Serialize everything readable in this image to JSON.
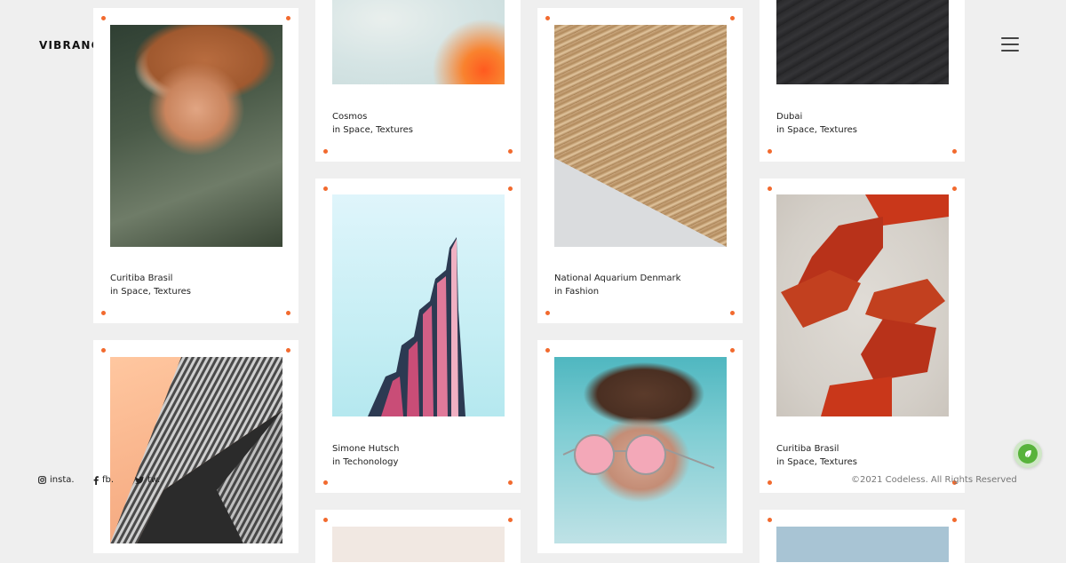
{
  "brand": {
    "logo": "VIBRANCE."
  },
  "cards": [
    {
      "title": "Curitiba Brasil",
      "meta": "in Space, Textures"
    },
    {
      "title": "Cosmos",
      "meta": "in Space, Textures"
    },
    {
      "title": "National Aquarium Denmark",
      "meta": "in Fashion"
    },
    {
      "title": "Dubai",
      "meta": "in Space, Textures"
    },
    {
      "title": "Simone Hutsch",
      "meta": "in Techonology"
    },
    {
      "title": "Curitiba Brasil",
      "meta": "in Space, Textures"
    }
  ],
  "footer": {
    "social": [
      {
        "label": "insta.",
        "icon": "instagram-icon"
      },
      {
        "label": "fb.",
        "icon": "facebook-icon"
      },
      {
        "label": "tw.",
        "icon": "twitter-icon"
      }
    ],
    "copyright": "©2021 Codeless. All Rights Reserved"
  },
  "colors": {
    "accent": "#f26a2e",
    "fab": "#58b33b",
    "background": "#efefef"
  }
}
